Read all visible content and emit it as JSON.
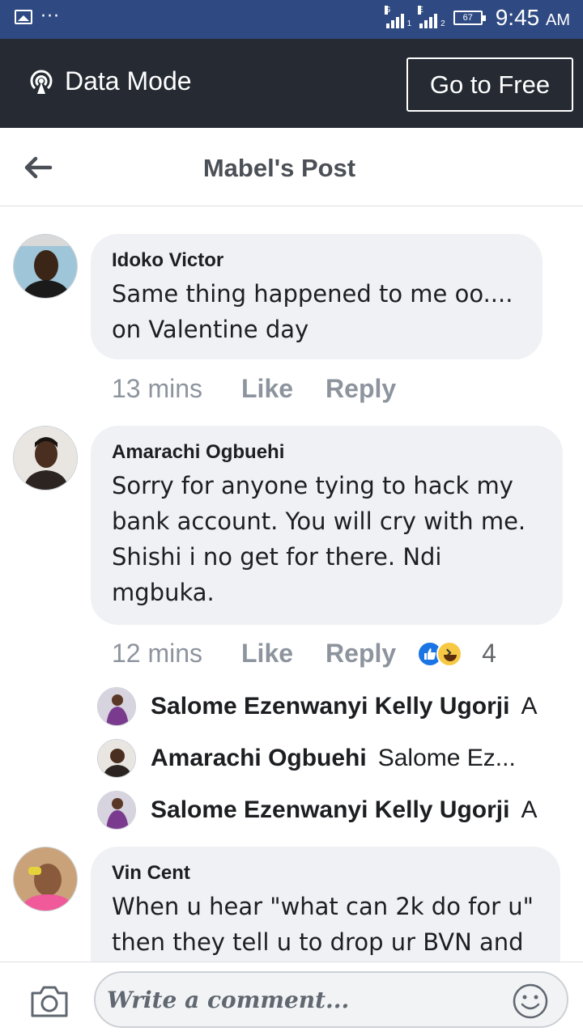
{
  "status_bar": {
    "time": "9:45",
    "ampm": "AM",
    "battery": "67",
    "sim1_tech": "G",
    "sim1_num": "1",
    "sim2_tech": "E",
    "sim2_num": "2",
    "icons": [
      "gallery-icon",
      "more-dots-icon",
      "signal-icon",
      "battery-icon"
    ]
  },
  "data_bar": {
    "label": "Data Mode",
    "button": "Go to Free"
  },
  "header": {
    "title": "Mabel's Post"
  },
  "comments": [
    {
      "name": "Idoko Victor",
      "lines": [
        "Same thing happened to me oo....",
        "on Valentine day"
      ],
      "time": "13 mins",
      "like": "Like",
      "reply": "Reply"
    },
    {
      "name": "Amarachi Ogbuehi",
      "lines": [
        "Sorry for anyone tying to hack my",
        "bank account. You will cry with me.",
        "Shishi i no get for there. Ndi",
        "mgbuka."
      ],
      "time": "12 mins",
      "like": "Like",
      "reply": "Reply",
      "reaction_count": "4",
      "replies": [
        {
          "name": "Salome Ezenwanyi Kelly Ugorji",
          "text": "A"
        },
        {
          "name": "Amarachi Ogbuehi",
          "text": "Salome Ez..."
        },
        {
          "name": "Salome Ezenwanyi Kelly Ugorji",
          "text": "A"
        }
      ]
    },
    {
      "name": "Vin Cent",
      "lines": [
        "When u hear \"what can 2k do for u\"",
        "then they tell u to drop ur BVN and"
      ]
    }
  ],
  "composer": {
    "placeholder": "Write a comment..."
  }
}
